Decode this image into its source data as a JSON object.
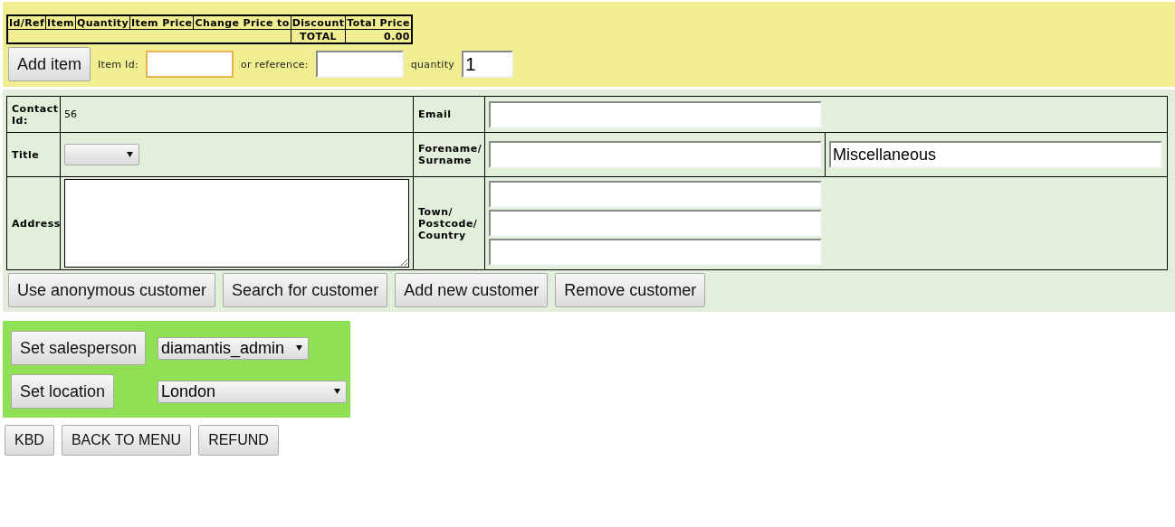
{
  "basket": {
    "columns": [
      "Id/Ref",
      "Item",
      "Quantity",
      "Item Price",
      "Change Price to",
      "Discount",
      "Total Price"
    ],
    "total_label": "TOTAL",
    "total_value": "0.00",
    "add_button": "Add item",
    "item_id": {
      "label": "Item Id:",
      "focused": true
    },
    "reference": {
      "label": "or reference:",
      "focused": false
    },
    "quantity": {
      "label": "quantity",
      "value": "1",
      "focused": false
    }
  },
  "customer": {
    "contact_id_label": "Contact Id:",
    "contact_id": "56",
    "title_label": "Title",
    "address_label": "Address",
    "email_label": "Email",
    "name_label": [
      "Forename/",
      "Surname"
    ],
    "surname": "Miscellaneous",
    "town_label": [
      "Town/",
      "Postcode/",
      "Country"
    ],
    "buttons": [
      "Use anonymous customer",
      "Search for customer",
      "Add new customer",
      "Remove customer"
    ]
  },
  "staff": {
    "salesperson_button": "Set salesperson",
    "salesperson": "diamantis_admin",
    "location_button": "Set location",
    "location": "London"
  },
  "footer": {
    "buttons": [
      "KBD",
      "BACK TO MENU",
      "REFUND"
    ]
  }
}
